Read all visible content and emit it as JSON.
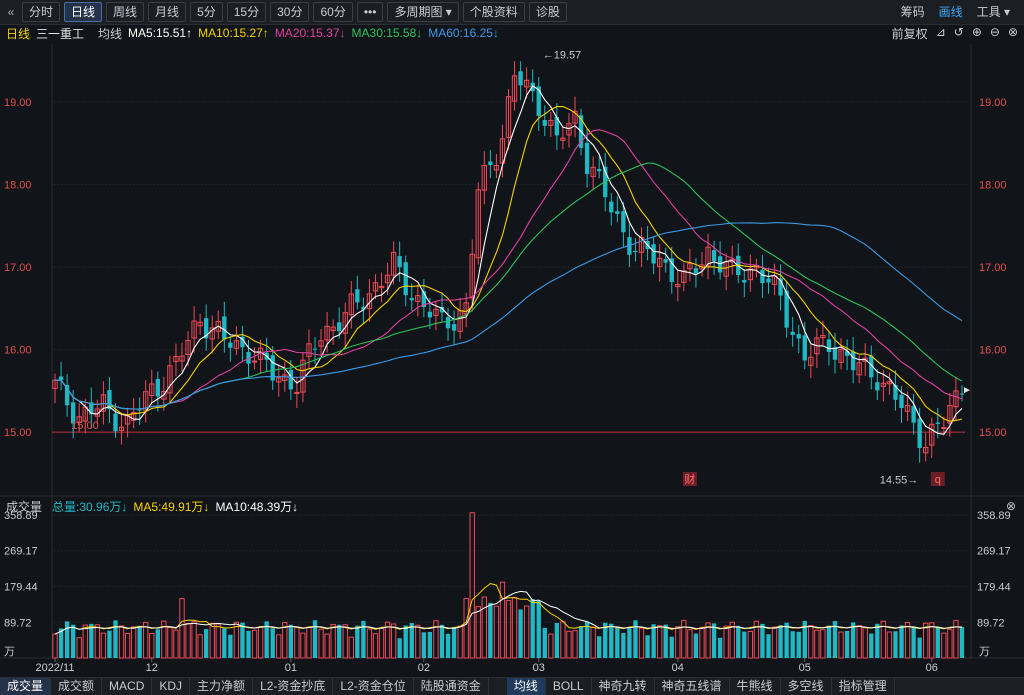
{
  "toolbar": {
    "back_icon": "«",
    "items": [
      "分时",
      "日线",
      "周线",
      "月线",
      "5分",
      "15分",
      "30分",
      "60分",
      "•••",
      "多周期图 ▾",
      "个股资料",
      "诊股"
    ],
    "active": 1,
    "right": [
      "筹码",
      "画线",
      "工具 ▾"
    ]
  },
  "legend": {
    "period": "日线",
    "name": "三一重工",
    "ma_label": "均线",
    "ma5": "MA5:15.51↑",
    "ma10": "MA10:15.27↑",
    "ma20": "MA20:15.37↓",
    "ma30": "MA30:15.58↓",
    "ma60": "MA60:16.25↓",
    "right": [
      "前复权"
    ]
  },
  "vol_legend": {
    "title": "成交量",
    "total": "总量:30.96万↓",
    "ma5": "MA5:49.91万↓",
    "ma10": "MA10:48.39万↓"
  },
  "bottombar": [
    "成交量",
    "成交额",
    "MACD",
    "KDJ",
    "主力净额",
    "L2-资金抄底",
    "L2-资金仓位",
    "陆股通资金",
    "均线",
    "BOLL",
    "神奇九转",
    "神奇五线谱",
    "牛熊线",
    "多空线",
    "指标管理"
  ],
  "colors": {
    "up": "#f24957",
    "down": "#1fb8c4",
    "ma5": "#ffffff",
    "ma10": "#f5d200",
    "ma20": "#e040a0",
    "ma30": "#2ec25a",
    "ma60": "#3a9ae8"
  },
  "chart_data": {
    "type": "candlestick",
    "price_ylim": [
      14.3,
      19.7
    ],
    "price_ticks": [
      "15.00",
      "16.00",
      "17.00",
      "18.00",
      "19.00"
    ],
    "volume_ylim": [
      0,
      358.89
    ],
    "volume_ticks": [
      "358.89",
      "269.17",
      "179.44",
      "89.72"
    ],
    "volume_unit": "万",
    "x_ticks": [
      {
        "label": "2022/11",
        "i": 0
      },
      {
        "label": "12",
        "i": 16
      },
      {
        "label": "01",
        "i": 39
      },
      {
        "label": "02",
        "i": 61
      },
      {
        "label": "03",
        "i": 80
      },
      {
        "label": "04",
        "i": 103
      },
      {
        "label": "05",
        "i": 124
      },
      {
        "label": "06",
        "i": 145
      }
    ],
    "annotations": [
      {
        "text": "19.57",
        "i": 80
      },
      {
        "text": "14.55",
        "i": 145
      },
      {
        "text": "15.00",
        "i": 3
      }
    ],
    "hline": 15.0,
    "markers": [
      {
        "text": "财",
        "i": 105
      },
      {
        "text": "q",
        "i": 146
      }
    ]
  }
}
